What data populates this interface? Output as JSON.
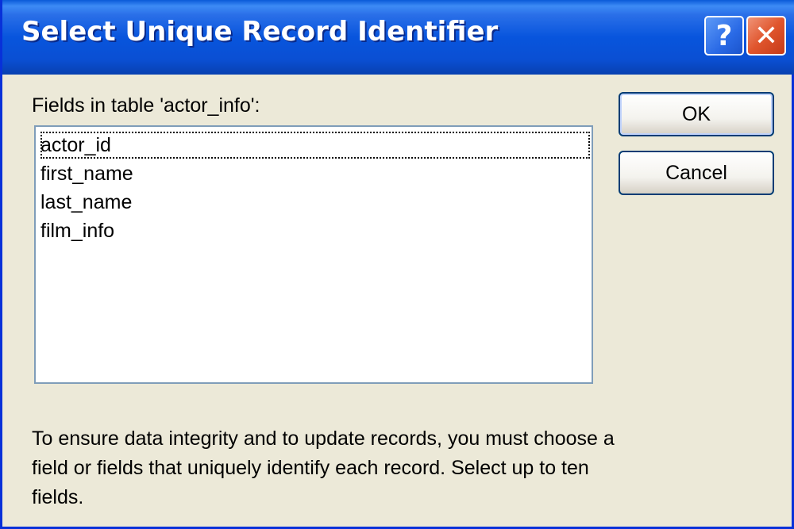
{
  "dialog": {
    "title": "Select Unique Record Identifier",
    "help_glyph": "?",
    "close_glyph": "✕",
    "fields_label": "Fields in table 'actor_info':",
    "fields": [
      "actor_id",
      "first_name",
      "last_name",
      "film_info"
    ],
    "selected_index": 0,
    "ok_label": "OK",
    "cancel_label": "Cancel",
    "help_text": "To ensure data integrity and to update records, you must choose a field or fields that uniquely identify each record. Select up to ten fields.",
    "colors": {
      "titlebar": "#0855dd",
      "face": "#ece9d8",
      "close_button": "#e0552d"
    }
  }
}
